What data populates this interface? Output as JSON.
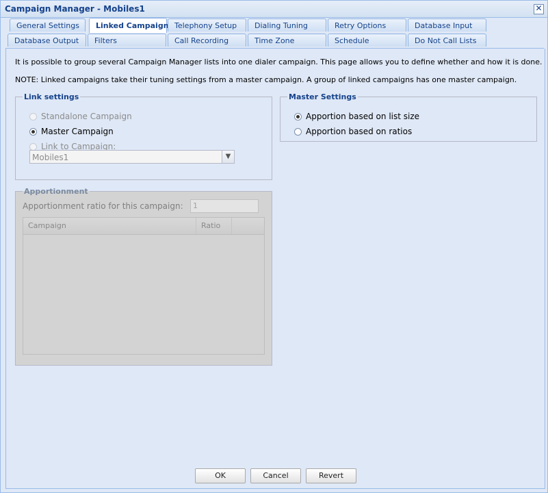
{
  "window": {
    "title": "Campaign Manager - Mobiles1",
    "close_glyph": "✕"
  },
  "tabs": {
    "row1": [
      "General Settings",
      "Linked Campaign",
      "Telephony Setup",
      "Dialing Tuning",
      "Retry Options",
      "Database Input"
    ],
    "row2": [
      "Database Output",
      "Filters",
      "Call Recording",
      "Time Zone",
      "Schedule",
      "Do Not Call Lists"
    ],
    "active": "Linked Campaign"
  },
  "intro": {
    "line1": "It is possible to group several Campaign Manager lists into one dialer campaign. This page allows you to define whether and how it is done.",
    "line2": "NOTE: Linked campaigns take their tuning settings from a master campaign. A group of linked campaigns has one master campaign."
  },
  "link_settings": {
    "legend": "Link settings",
    "options": [
      "Standalone Campaign",
      "Master Campaign",
      "Link to Campaign:"
    ],
    "selected": "Master Campaign",
    "campaign_combo": {
      "value": "Mobiles1"
    }
  },
  "master_settings": {
    "legend": "Master Settings",
    "options": [
      "Apportion based on list size",
      "Apportion based on ratios"
    ],
    "selected": "Apportion based on list size"
  },
  "apportionment": {
    "legend": "Apportionment",
    "ratio_label": "Apportionment ratio for this campaign:",
    "ratio_value": "1",
    "columns": [
      "Campaign",
      "Ratio"
    ]
  },
  "buttons": {
    "ok": "OK",
    "cancel": "Cancel",
    "revert": "Revert"
  },
  "colors": {
    "accent": "#15428b",
    "background": "#dfe8f6",
    "border": "#99bbe8"
  }
}
